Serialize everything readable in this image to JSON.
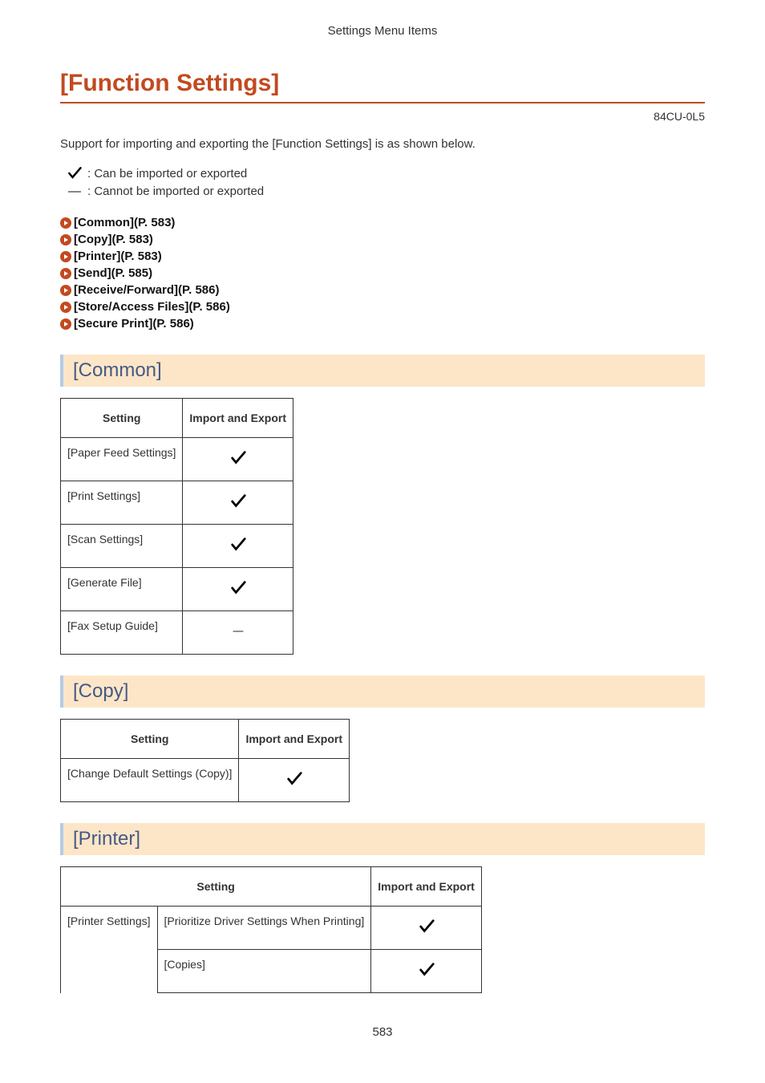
{
  "chapter": "Settings Menu Items",
  "title": "[Function Settings]",
  "doc_code": "84CU-0L5",
  "intro": "Support for importing and exporting the [Function Settings] is as shown below.",
  "legend": {
    "can": ": Can be imported or exported",
    "cannot": ": Cannot be imported or exported"
  },
  "toc": [
    {
      "label": "[Common](P. 583)"
    },
    {
      "label": "[Copy](P. 583)"
    },
    {
      "label": "[Printer](P. 583)"
    },
    {
      "label": "[Send](P. 585)"
    },
    {
      "label": "[Receive/Forward](P. 586)"
    },
    {
      "label": "[Store/Access Files](P. 586)"
    },
    {
      "label": "[Secure Print](P. 586)"
    }
  ],
  "sections": {
    "common": {
      "heading": "[Common]",
      "headers": {
        "setting": "Setting",
        "ie": "Import and Export"
      },
      "rows": [
        {
          "setting": "[Paper Feed Settings]",
          "ie": "check"
        },
        {
          "setting": "[Print Settings]",
          "ie": "check"
        },
        {
          "setting": "[Scan Settings]",
          "ie": "check"
        },
        {
          "setting": "[Generate File]",
          "ie": "check"
        },
        {
          "setting": "[Fax Setup Guide]",
          "ie": "dash"
        }
      ]
    },
    "copy": {
      "heading": "[Copy]",
      "headers": {
        "setting": "Setting",
        "ie": "Import and Export"
      },
      "rows": [
        {
          "setting": "[Change Default Settings (Copy)]",
          "ie": "check"
        }
      ]
    },
    "printer": {
      "heading": "[Printer]",
      "headers": {
        "setting": "Setting",
        "ie": "Import and Export"
      },
      "group_label": "[Printer Settings]",
      "rows": [
        {
          "setting": "[Prioritize Driver Settings When Printing]",
          "ie": "check"
        },
        {
          "setting": "[Copies]",
          "ie": "check"
        }
      ]
    }
  },
  "page_number": "583"
}
